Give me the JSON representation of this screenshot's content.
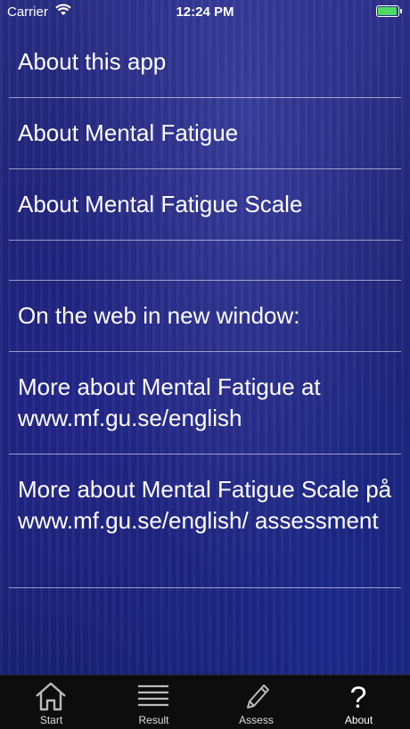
{
  "status_bar": {
    "carrier": "Carrier",
    "time": "12:24 PM",
    "battery_color": "#4cd964"
  },
  "menu": {
    "items": [
      {
        "label": "About this app"
      },
      {
        "label": "About Mental Fatigue"
      },
      {
        "label": "About Mental Fatigue Scale"
      },
      {
        "label": ""
      },
      {
        "label": "On the web in new window:"
      },
      {
        "label": "More about Mental Fatigue at www.mf.gu.se/english"
      },
      {
        "label": "More about Mental Fatigue Scale på www.mf.gu.se/english/ assessment"
      }
    ]
  },
  "tabbar": {
    "tabs": [
      {
        "label": "Start",
        "icon": "home-icon"
      },
      {
        "label": "Result",
        "icon": "list-icon"
      },
      {
        "label": "Assess",
        "icon": "pencil-icon"
      },
      {
        "label": "About",
        "icon": "question-mark-icon",
        "active": true
      }
    ]
  }
}
